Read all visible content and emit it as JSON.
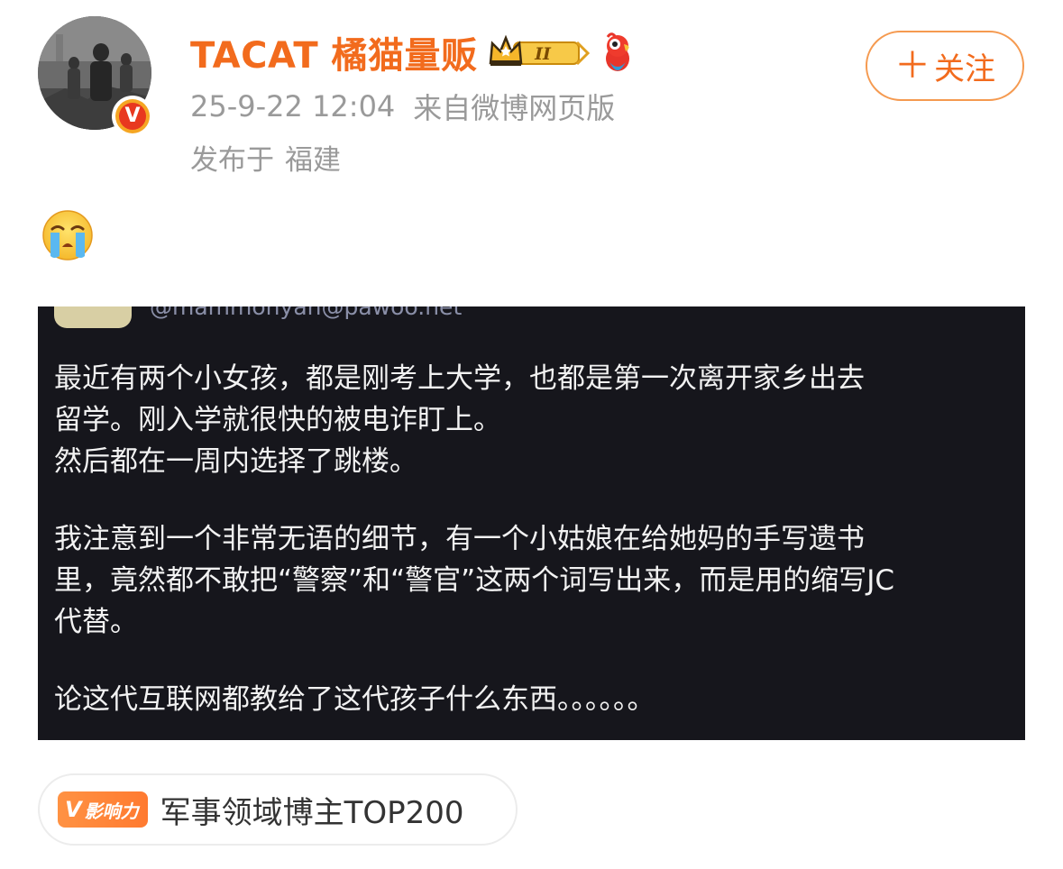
{
  "header": {
    "username": "TACAT 橘猫量贩",
    "vip_level": "II",
    "timestamp": "25-9-22 12:04",
    "source": "来自微博网页版",
    "location_prefix": "发布于",
    "location": "福建",
    "follow_label": "关注",
    "verified_letter": "V"
  },
  "post": {
    "emoji": "crying-face-icon",
    "image": {
      "partial_handle": "@mammonyan@pawoo.net",
      "lines": [
        "最近有两个小女孩，都是刚考上大学，也都是第一次离开家乡出去",
        "留学。刚入学就很快的被电诈盯上。",
        "然后都在一周内选择了跳楼。",
        "我注意到一个非常无语的细节，有一个小姑娘在给她妈的手写遗书",
        "里，竟然都不敢把“警察”和“警官”这两个词写出来，而是用的缩写JC",
        "代替。",
        "论这代互联网都教给了这代孩子什么东西。。。。。。"
      ]
    }
  },
  "influence_tag": {
    "badge_v": "V",
    "badge_text": "影响力",
    "label": "军事领域博主TOP200"
  },
  "colors": {
    "accent": "#f26b1d",
    "meta_gray": "#9a9a9a",
    "image_bg": "#16161c",
    "image_text": "#f2f2f2"
  }
}
